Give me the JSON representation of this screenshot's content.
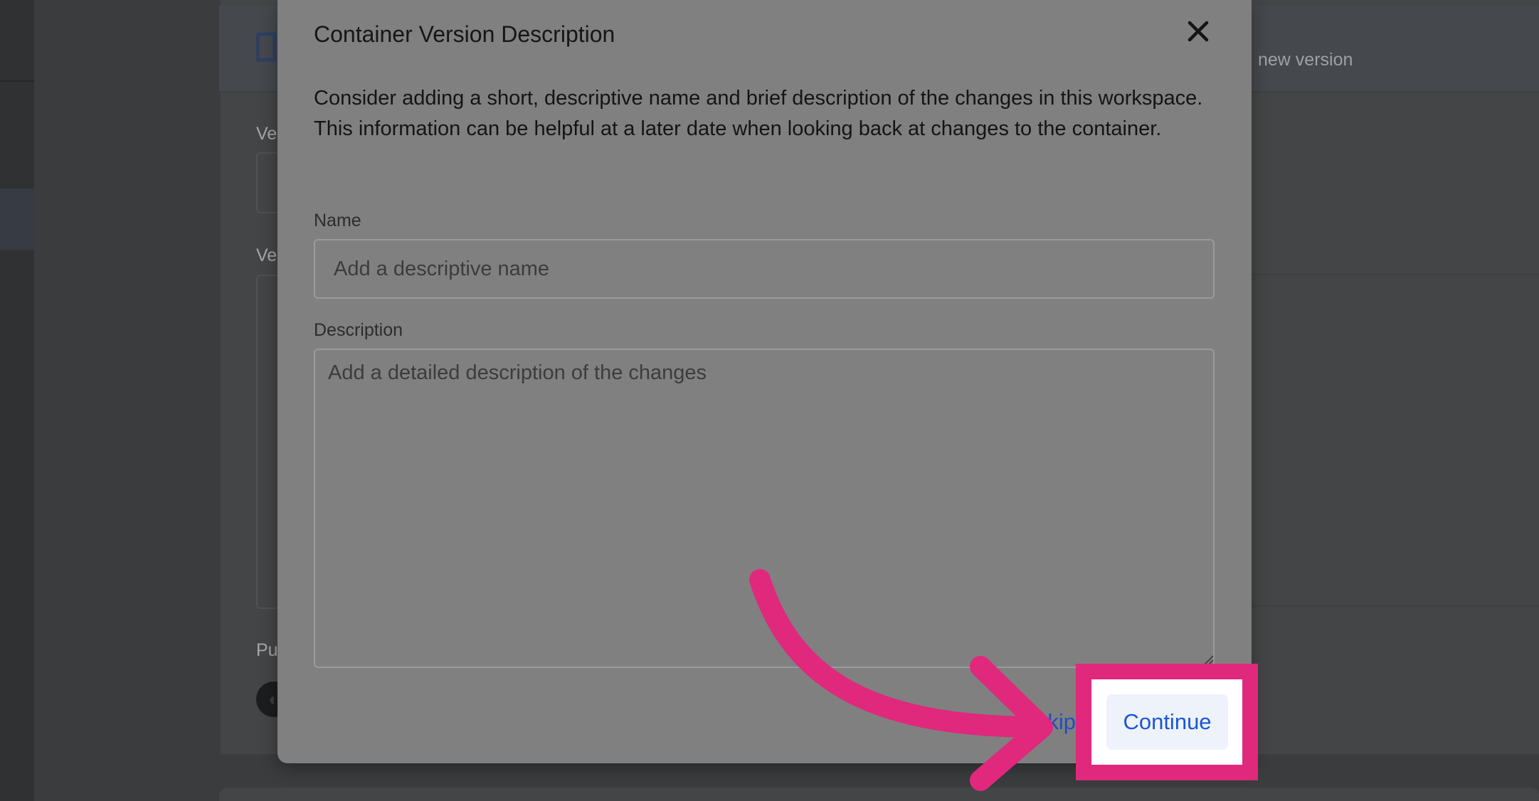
{
  "background": {
    "header_text": "new version",
    "labels": [
      "Ve",
      "Ve",
      "Pu"
    ]
  },
  "dialog": {
    "title": "Container Version Description",
    "description": "Consider adding a short, descriptive name and brief description of the changes in this workspace. This information can be helpful at a later date when looking back at changes to the container.",
    "name_label": "Name",
    "name_placeholder": "Add a descriptive name",
    "name_value": "",
    "description_label": "Description",
    "description_placeholder": "Add a detailed description of the changes",
    "description_value": "",
    "skip_label": "Skip",
    "continue_label": "Continue"
  },
  "annotation": {
    "highlight_color": "#e0287c",
    "target": "continue-button"
  },
  "colors": {
    "dialog_bg": "#808080",
    "link_blue": "#1a56d6"
  }
}
